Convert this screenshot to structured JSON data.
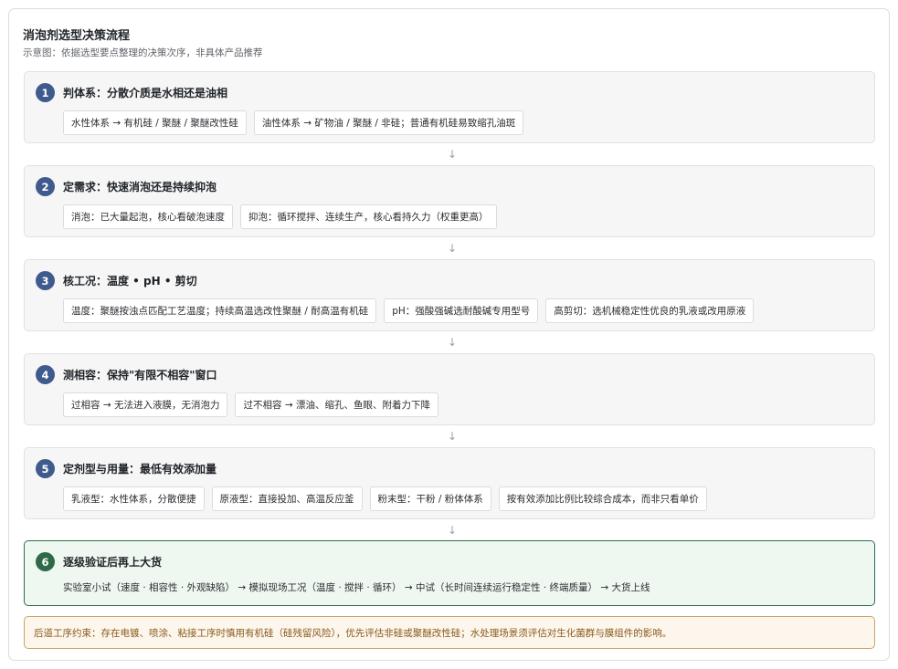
{
  "header": {
    "title": "消泡剂选型决策流程",
    "subtitle": "示意图：依据选型要点整理的决策次序，非具体产品推荐"
  },
  "steps": [
    {
      "num": "1",
      "title": "判体系：分散介质是水相还是油相",
      "chips": [
        "水性体系 → 有机硅 / 聚醚 / 聚醚改性硅",
        "油性体系 → 矿物油 / 聚醚 / 非硅；普通有机硅易致缩孔油斑"
      ]
    },
    {
      "num": "2",
      "title": "定需求：快速消泡还是持续抑泡",
      "chips": [
        "消泡：已大量起泡，核心看破泡速度",
        "抑泡：循环搅拌、连续生产，核心看持久力（权重更高）"
      ]
    },
    {
      "num": "3",
      "title": "核工况：温度 • pH • 剪切",
      "chips": [
        "温度：聚醚按浊点匹配工艺温度；持续高温选改性聚醚 / 耐高温有机硅",
        "pH：强酸强碱选耐酸碱专用型号",
        "高剪切：选机械稳定性优良的乳液或改用原液"
      ]
    },
    {
      "num": "4",
      "title": "测相容：保持\"有限不相容\"窗口",
      "chips": [
        "过相容 → 无法进入液膜，无消泡力",
        "过不相容 → 漂油、缩孔、鱼眼、附着力下降"
      ]
    },
    {
      "num": "5",
      "title": "定剂型与用量：最低有效添加量",
      "chips": [
        "乳液型：水性体系，分散便捷",
        "原液型：直接投加、高温反应釜",
        "粉末型：干粉 / 粉体体系",
        "按有效添加比例比较综合成本，而非只看单价"
      ]
    },
    {
      "num": "6",
      "title": "逐级验证后再上大货",
      "flow": "实验室小试（速度 · 相容性 · 外观缺陷） → 模拟现场工况（温度 · 搅拌 · 循环） → 中试（长时间连续运行稳定性 · 终端质量） → 大货上线"
    }
  ],
  "arrow_glyph": "↓",
  "note": "后道工序约束：存在电镀、喷涂、粘接工序时慎用有机硅（硅残留风险），优先评估非硅或聚醚改性硅；水处理场景须评估对生化菌群与膜组件的影响。"
}
